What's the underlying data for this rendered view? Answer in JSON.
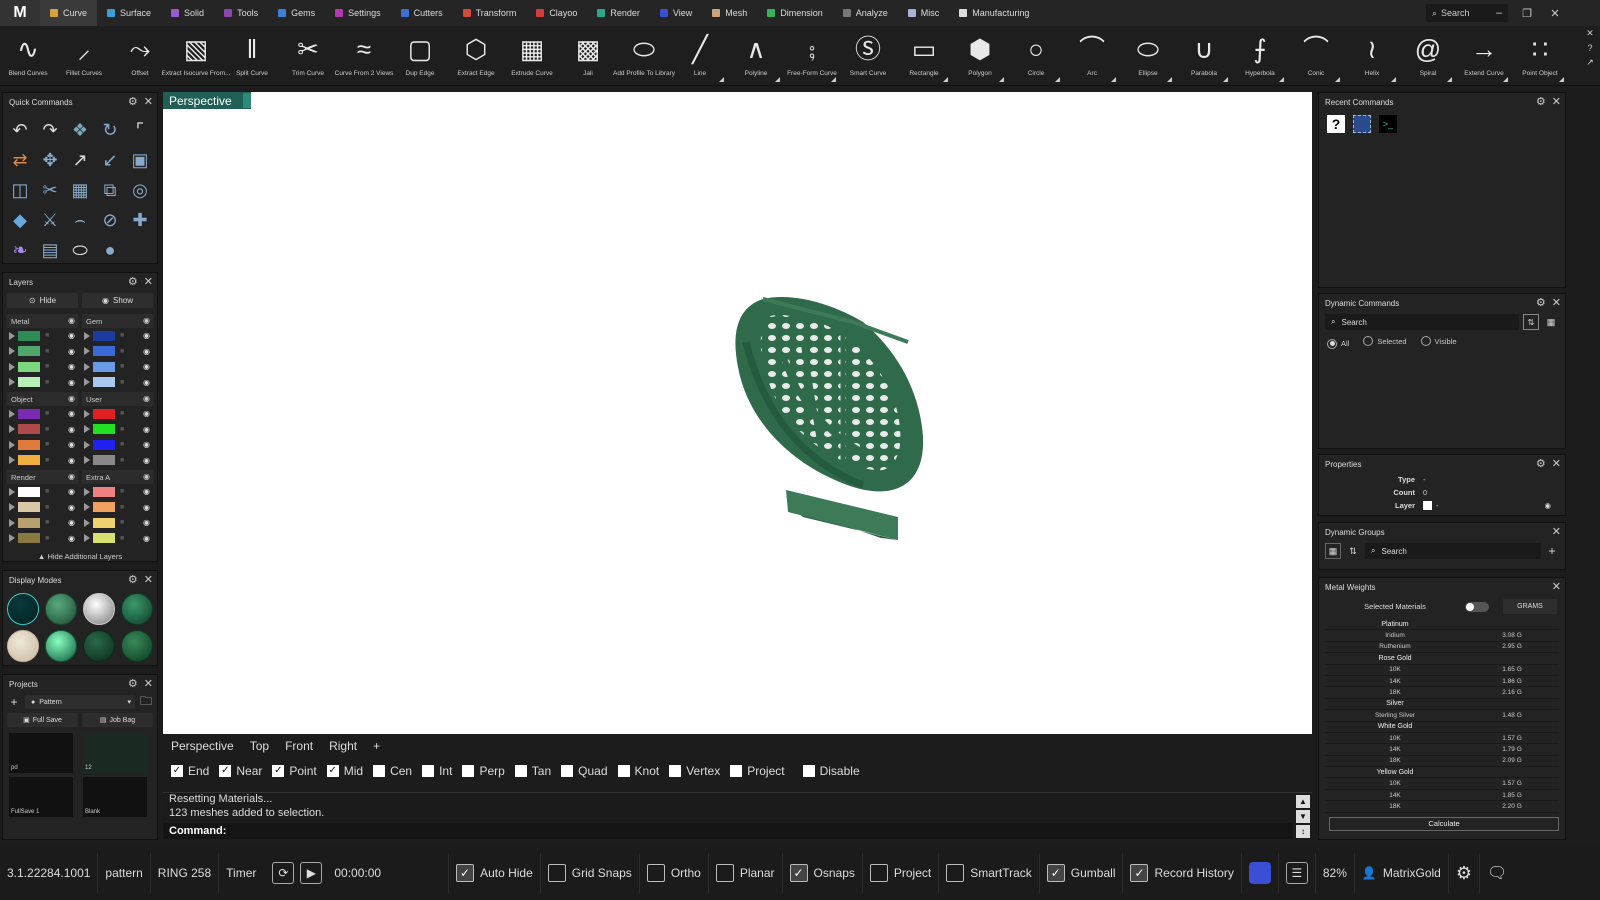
{
  "app": {
    "logo": "M"
  },
  "menu": {
    "tabs": [
      {
        "label": "Curve",
        "color": "#d9a23b"
      },
      {
        "label": "Surface",
        "color": "#3aa0d6"
      },
      {
        "label": "Solid",
        "color": "#9b59d0"
      },
      {
        "label": "Tools",
        "color": "#8e44ad"
      },
      {
        "label": "Gems",
        "color": "#3b7fd6"
      },
      {
        "label": "Settings",
        "color": "#b03ab0"
      },
      {
        "label": "Cutters",
        "color": "#3b6fd6"
      },
      {
        "label": "Transform",
        "color": "#d64a3b"
      },
      {
        "label": "Clayoo",
        "color": "#d63b3b"
      },
      {
        "label": "Render",
        "color": "#2aa88a"
      },
      {
        "label": "View",
        "color": "#3b4fd6"
      },
      {
        "label": "Mesh",
        "color": "#c9a67a"
      },
      {
        "label": "Dimension",
        "color": "#3bb05a"
      },
      {
        "label": "Analyze",
        "color": "#777777"
      },
      {
        "label": "Misc",
        "color": "#aab0d6"
      },
      {
        "label": "Manufacturing",
        "color": "#dddddd"
      }
    ],
    "search_placeholder": "Search"
  },
  "toolbar": {
    "tools": [
      {
        "label": "Blend Curves",
        "icon": "blend-curves-icon",
        "corner": false
      },
      {
        "label": "Fillet Curves",
        "icon": "fillet-curves-icon",
        "corner": false
      },
      {
        "label": "Offset",
        "icon": "offset-icon",
        "corner": false
      },
      {
        "label": "Extract Isocurve From...",
        "icon": "extract-isocurve-icon",
        "corner": false
      },
      {
        "label": "Split Curve",
        "icon": "split-curve-icon",
        "corner": false
      },
      {
        "label": "Trim Curve",
        "icon": "trim-curve-icon",
        "corner": false
      },
      {
        "label": "Curve From 2 Views",
        "icon": "curve-from-2-views-icon",
        "corner": false
      },
      {
        "label": "Dup Edge",
        "icon": "dup-edge-icon",
        "corner": false
      },
      {
        "label": "Extract Edge",
        "icon": "extract-edge-icon",
        "corner": false
      },
      {
        "label": "Extrude Curve",
        "icon": "extrude-curve-icon",
        "corner": false
      },
      {
        "label": "Jali",
        "icon": "jali-icon",
        "corner": false
      },
      {
        "label": "Add Profile To Library",
        "icon": "add-profile-icon",
        "corner": false
      },
      {
        "label": "Line",
        "icon": "line-icon",
        "corner": true
      },
      {
        "label": "Polyline",
        "icon": "polyline-icon",
        "corner": true
      },
      {
        "label": "Free-Form Curve",
        "icon": "free-form-curve-icon",
        "corner": true
      },
      {
        "label": "Smart Curve",
        "icon": "smart-curve-icon",
        "corner": false
      },
      {
        "label": "Rectangle",
        "icon": "rectangle-icon",
        "corner": true
      },
      {
        "label": "Polygon",
        "icon": "polygon-icon",
        "corner": true
      },
      {
        "label": "Circle",
        "icon": "circle-icon",
        "corner": true
      },
      {
        "label": "Arc",
        "icon": "arc-icon",
        "corner": true
      },
      {
        "label": "Ellipse",
        "icon": "ellipse-icon",
        "corner": true
      },
      {
        "label": "Parabola",
        "icon": "parabola-icon",
        "corner": true
      },
      {
        "label": "Hyperbola",
        "icon": "hyperbola-icon",
        "corner": true
      },
      {
        "label": "Conic",
        "icon": "conic-icon",
        "corner": true
      },
      {
        "label": "Helix",
        "icon": "helix-icon",
        "corner": true
      },
      {
        "label": "Spiral",
        "icon": "spiral-icon",
        "corner": true
      },
      {
        "label": "Extend Curve",
        "icon": "extend-curve-icon",
        "corner": true
      },
      {
        "label": "Point Object",
        "icon": "point-object-icon",
        "corner": true
      }
    ]
  },
  "quick_commands": {
    "title": "Quick Commands"
  },
  "layers": {
    "title": "Layers",
    "hide_label": "Hide",
    "show_label": "Show",
    "left": [
      {
        "name": "Metal",
        "colors": [
          "#2e8b57",
          "#4fa86a",
          "#7ed67e",
          "#b8f0b8"
        ]
      },
      {
        "name": "Object",
        "colors": [
          "#7a2ab0",
          "#b04a4a",
          "#e07a3b",
          "#f0b040"
        ]
      },
      {
        "name": "Render",
        "colors": [
          "#ffffff",
          "#d8c8a8",
          "#b8a070",
          "#8a7a40"
        ]
      }
    ],
    "right": [
      {
        "name": "Gem",
        "colors": [
          "#1a3aa0",
          "#3a6ad6",
          "#6a9ae6",
          "#a8c8f0"
        ]
      },
      {
        "name": "User",
        "colors": [
          "#e02020",
          "#20e020",
          "#2020f0",
          "#888888"
        ]
      },
      {
        "name": "Extra A",
        "colors": [
          "#f08080",
          "#f0a060",
          "#f0d070",
          "#d8e070"
        ]
      }
    ],
    "hide_additional": "Hide Additional Layers"
  },
  "display_modes": {
    "title": "Display Modes",
    "modes": [
      {
        "name": "wireframe-mode",
        "bg": "radial-gradient(circle at 40% 35%, #0a3a3a, #002020)",
        "border": "#3cc"
      },
      {
        "name": "shaded-mode",
        "bg": "radial-gradient(circle at 40% 35%, #5aaa80, #1a4a30)",
        "border": "#1a4a30"
      },
      {
        "name": "xray-mode",
        "bg": "radial-gradient(circle at 40% 35%, #fff, #777)",
        "border": "#ccc"
      },
      {
        "name": "rendered-mode",
        "bg": "radial-gradient(circle at 40% 35%, #3a9a6a, #0e3a25)",
        "border": "#0e3a25"
      },
      {
        "name": "clay-mode",
        "bg": "radial-gradient(circle at 40% 35%, #f0e8d8, #c8b8a0)",
        "border": "#c8b8a0"
      },
      {
        "name": "glossy-mode",
        "bg": "radial-gradient(circle at 40% 35%, #8affc0, #0a5a3a)",
        "border": "#0a5a3a"
      },
      {
        "name": "user-mode-1",
        "bg": "radial-gradient(circle at 40% 35%, #2a6a4a, #0a2a1a)",
        "border": "#0a2a1a"
      },
      {
        "name": "user-mode-2",
        "bg": "radial-gradient(circle at 40% 35%, #3a8a5a, #0a3a20)",
        "border": "#0a3a20"
      }
    ]
  },
  "projects": {
    "title": "Projects",
    "selected": "Pattern",
    "full_save": "Full Save",
    "job_bag": "Job Bag",
    "thumbs": [
      {
        "label": "pd"
      },
      {
        "label": "12"
      },
      {
        "label": "FullSave 1"
      },
      {
        "label": "Blank"
      }
    ]
  },
  "viewport": {
    "active_view": "Perspective"
  },
  "view_tabs": [
    "Perspective",
    "Top",
    "Front",
    "Right",
    "+"
  ],
  "snaps": [
    {
      "label": "End",
      "checked": true
    },
    {
      "label": "Near",
      "checked": true
    },
    {
      "label": "Point",
      "checked": true
    },
    {
      "label": "Mid",
      "checked": true
    },
    {
      "label": "Cen",
      "checked": false
    },
    {
      "label": "Int",
      "checked": false
    },
    {
      "label": "Perp",
      "checked": false
    },
    {
      "label": "Tan",
      "checked": false
    },
    {
      "label": "Quad",
      "checked": false
    },
    {
      "label": "Knot",
      "checked": false
    },
    {
      "label": "Vertex",
      "checked": false
    },
    {
      "label": "Project",
      "checked": false
    },
    {
      "label": "Disable",
      "checked": false
    }
  ],
  "command": {
    "history": [
      "Resetting Materials...",
      "123 meshes added to selection."
    ],
    "prompt": "Command:"
  },
  "recent_commands": {
    "title": "Recent Commands"
  },
  "dynamic_commands": {
    "title": "Dynamic Commands",
    "search_placeholder": "Search",
    "filters": [
      {
        "label": "All",
        "on": true
      },
      {
        "label": "Selected",
        "on": false
      },
      {
        "label": "Visible",
        "on": false
      }
    ]
  },
  "properties": {
    "title": "Properties",
    "rows": [
      {
        "key": "Type",
        "value": "-"
      },
      {
        "key": "Count",
        "value": "0"
      },
      {
        "key": "Layer",
        "value": "-"
      }
    ]
  },
  "dynamic_groups": {
    "title": "Dynamic Groups",
    "search_placeholder": "Search"
  },
  "metal_weights": {
    "title": "Metal Weights",
    "selected_materials": "Selected Materials",
    "unit": "GRAMS",
    "rows": [
      {
        "name": "Platinum",
        "weight": "",
        "group": true
      },
      {
        "name": "Iridium",
        "weight": "3.08 G",
        "group": false
      },
      {
        "name": "Ruthenium",
        "weight": "2.95 G",
        "group": false
      },
      {
        "name": "Rose Gold",
        "weight": "",
        "group": true
      },
      {
        "name": "10K",
        "weight": "1.65 G",
        "group": false
      },
      {
        "name": "14K",
        "weight": "1.86 G",
        "group": false
      },
      {
        "name": "18K",
        "weight": "2.16 G",
        "group": false
      },
      {
        "name": "Silver",
        "weight": "",
        "group": true
      },
      {
        "name": "Sterling Silver",
        "weight": "1.48 G",
        "group": false
      },
      {
        "name": "White Gold",
        "weight": "",
        "group": true
      },
      {
        "name": "10K",
        "weight": "1.57 G",
        "group": false
      },
      {
        "name": "14K",
        "weight": "1.79 G",
        "group": false
      },
      {
        "name": "18K",
        "weight": "2.09 G",
        "group": false
      },
      {
        "name": "Yellow Gold",
        "weight": "",
        "group": true
      },
      {
        "name": "10K",
        "weight": "1.57 G",
        "group": false
      },
      {
        "name": "14K",
        "weight": "1.85 G",
        "group": false
      },
      {
        "name": "18K",
        "weight": "2.20 G",
        "group": false
      }
    ],
    "calculate": "Calculate"
  },
  "status": {
    "version": "3.1.22284.1001",
    "project": "pattern",
    "model": "RING 258",
    "timer_label": "Timer",
    "timer_value": "00:00:00",
    "toggles": [
      {
        "label": "Auto Hide",
        "on": true
      },
      {
        "label": "Grid Snaps",
        "on": false
      },
      {
        "label": "Ortho",
        "on": false
      },
      {
        "label": "Planar",
        "on": false
      },
      {
        "label": "Osnaps",
        "on": true
      },
      {
        "label": "Project",
        "on": false
      },
      {
        "label": "SmartTrack",
        "on": false
      },
      {
        "label": "Gumball",
        "on": true
      },
      {
        "label": "Record History",
        "on": true
      }
    ],
    "zoom": "82%",
    "user": "MatrixGold"
  },
  "colors": {
    "accent": "#1f5f55",
    "model": "#2f6b4a"
  }
}
